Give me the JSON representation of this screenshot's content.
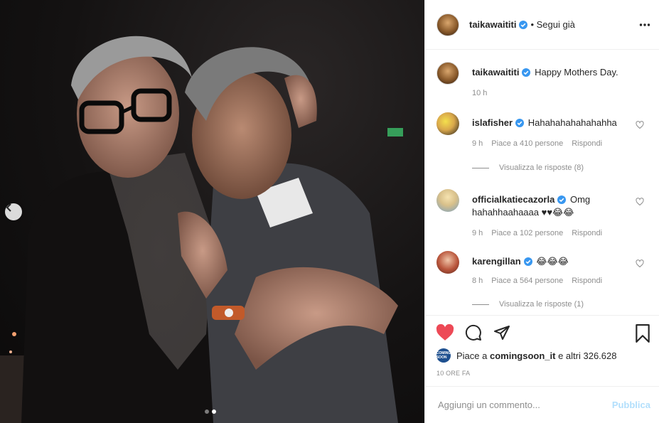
{
  "post": {
    "author": "taikawaititi",
    "follow_state": "• Segui già",
    "caption": "Happy Mothers Day.",
    "caption_age": "10 h",
    "carousel": {
      "count": 2,
      "active_index": 1
    }
  },
  "comments": [
    {
      "user": "islafisher",
      "verified": true,
      "text": "Hahahahahahahahha",
      "age": "9 h",
      "likes": "Piace a 410 persone",
      "reply": "Rispondi",
      "view_replies": "Visualizza le risposte (8)"
    },
    {
      "user": "officialkatiecazorla",
      "verified": true,
      "text": "Omg hahahhaahaaaa ♥♥😂😂",
      "age": "9 h",
      "likes": "Piace a 102 persone",
      "reply": "Rispondi"
    },
    {
      "user": "karengillan",
      "verified": true,
      "text": "😂😂😂",
      "age": "8 h",
      "likes": "Piace a 564 persone",
      "reply": "Rispondi",
      "view_replies": "Visualizza le risposte (1)"
    }
  ],
  "likes_summary": {
    "prefix": "Piace a",
    "user": "comingsoon_it",
    "suffix": "e altri 326.628",
    "mini_avatar_text": "COMING SOON"
  },
  "post_time": "10 ORE FA",
  "composer": {
    "placeholder": "Aggiungi un commento...",
    "post_label": "Pubblica"
  },
  "icons": {
    "prev": "chevron-left-icon",
    "more": "more-horizontal-icon",
    "verified": "verified-badge-icon",
    "like": "heart-filled-icon",
    "comment": "comment-icon",
    "share": "paper-plane-icon",
    "save": "bookmark-icon"
  },
  "colors": {
    "like_red": "#ed4956",
    "verified_blue": "#3897f0",
    "link_disabled": "#b2dffc"
  }
}
